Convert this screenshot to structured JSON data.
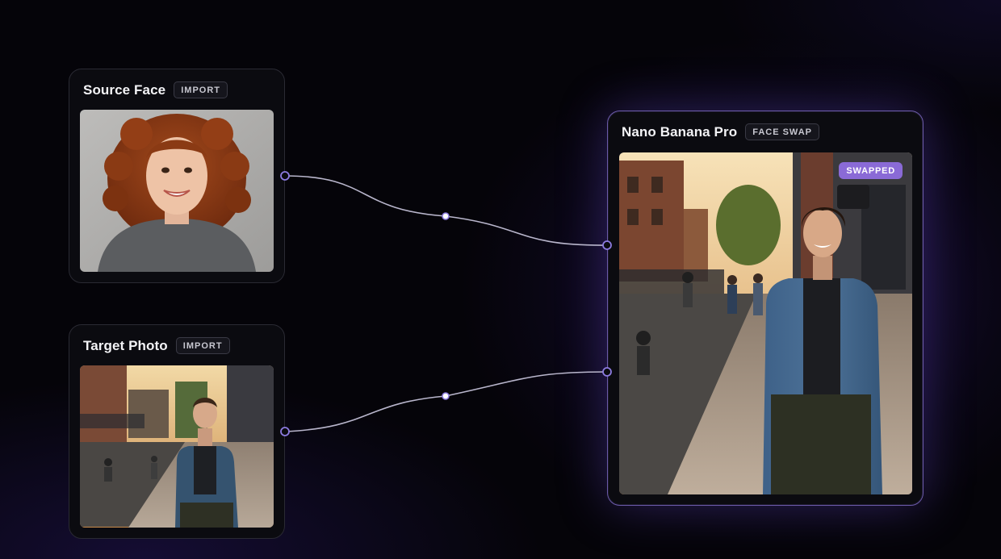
{
  "nodes": {
    "source": {
      "title": "Source Face",
      "tag": "IMPORT",
      "image_icon": "portrait-photo"
    },
    "target": {
      "title": "Target Photo",
      "tag": "IMPORT",
      "image_icon": "street-photo"
    },
    "result": {
      "title": "Nano Banana Pro",
      "tag": "FACE SWAP",
      "badge": "SWAPPED",
      "image_icon": "street-photo"
    }
  },
  "colors": {
    "accent": "#8a6ad6",
    "wire": "#b9b6cc",
    "port": "#8c7be0",
    "background": "#050409"
  }
}
